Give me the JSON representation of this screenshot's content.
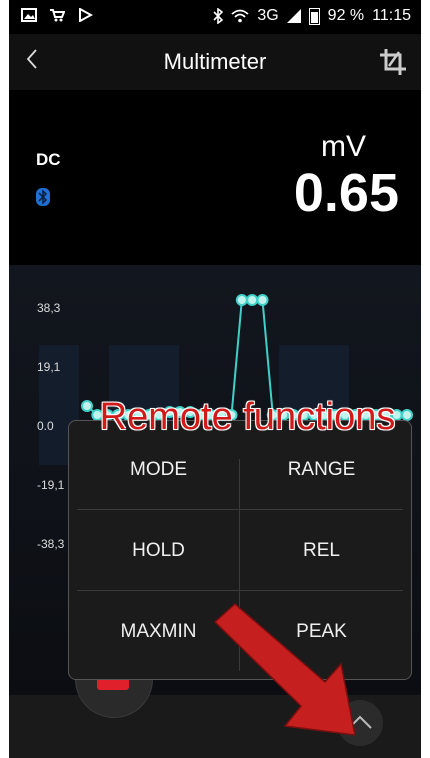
{
  "status_bar": {
    "signal_label": "3G",
    "battery": "92 %",
    "time": "11:15"
  },
  "header": {
    "title": "Multimeter"
  },
  "readout": {
    "mode": "DC",
    "unit": "mV",
    "value": "0.65"
  },
  "graph": {
    "y_ticks": [
      "38,3",
      "19,1",
      "0.0",
      "-19,1",
      "-38,3"
    ],
    "trace_color": "#3fd1c8",
    "samples": [
      3,
      0,
      0,
      0,
      0,
      0,
      0,
      0,
      1,
      1,
      1,
      0,
      0,
      0,
      0,
      38.3,
      38.3,
      38.3,
      0,
      0,
      0,
      0,
      0,
      0,
      0,
      0,
      0,
      0,
      0,
      0,
      0,
      0
    ]
  },
  "overlay_annotation": "Remote functions",
  "remote_functions": {
    "mode_label": "MODE",
    "range_label": "RANGE",
    "hold_label": "HOLD",
    "rel_label": "REL",
    "maxmin_label": "MAXMIN",
    "peak_label": "PEAK"
  },
  "icons": {
    "back": "chevron-left-icon",
    "crop": "crop-icon",
    "bluetooth": "bluetooth-icon",
    "record": "record-icon",
    "expand": "chevron-up-icon"
  }
}
